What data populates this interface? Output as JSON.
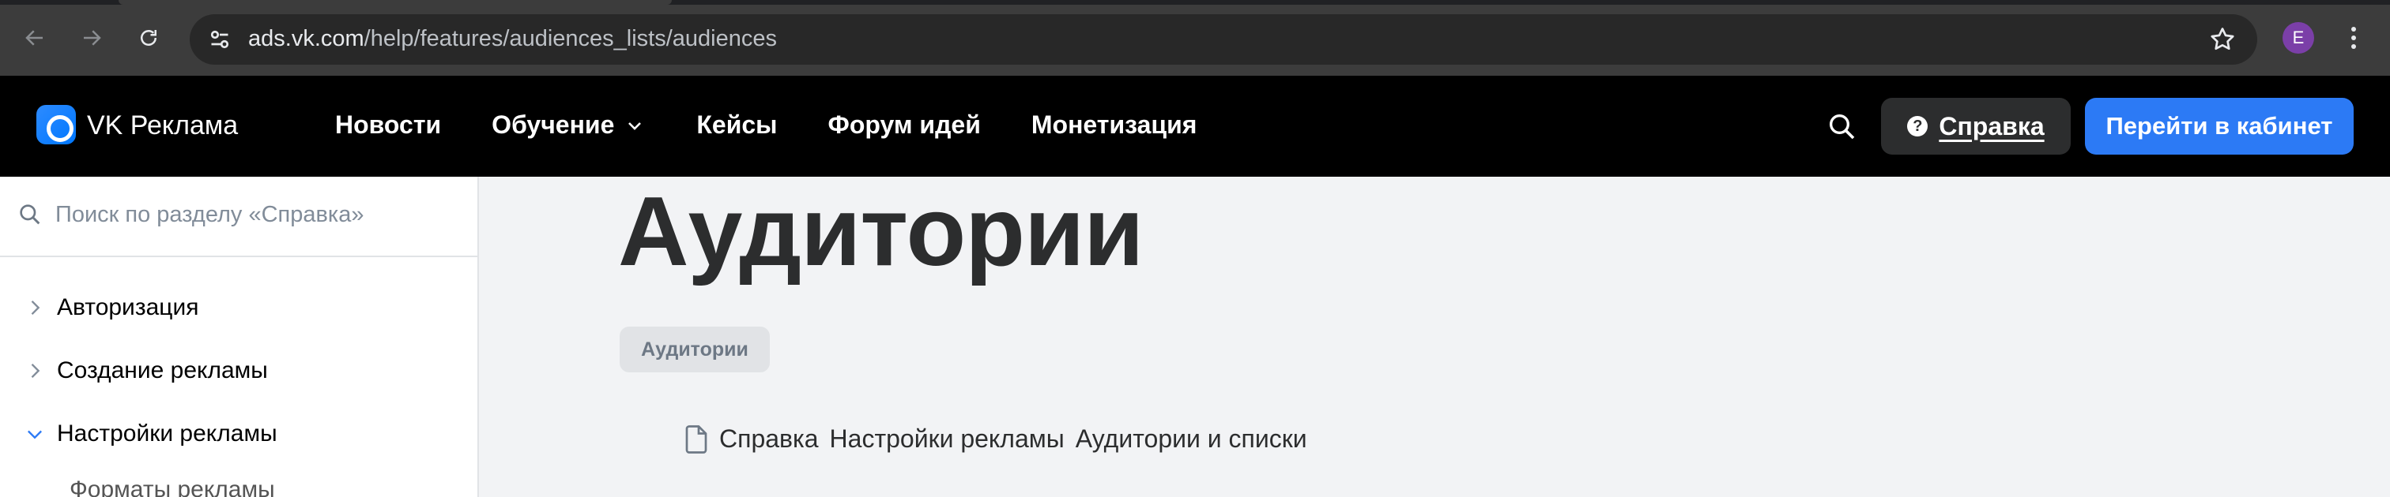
{
  "browser": {
    "url_host": "ads.vk.com",
    "url_path": "/help/features/audiences_lists/audiences",
    "profile_initial": "E"
  },
  "header": {
    "brand": "VK Реклама",
    "nav": [
      "Новости",
      "Обучение",
      "Кейсы",
      "Форум идей",
      "Монетизация"
    ],
    "help_label": "Справка",
    "cabinet_label": "Перейти в кабинет"
  },
  "sidebar": {
    "search_placeholder": "Поиск по разделу «Справка»",
    "items": [
      {
        "label": "Авторизация",
        "expanded": false
      },
      {
        "label": "Создание рекламы",
        "expanded": false
      },
      {
        "label": "Настройки рекламы",
        "expanded": true
      }
    ],
    "subitem": "Форматы рекламы"
  },
  "main": {
    "title": "Аудитории",
    "tag": "Аудитории",
    "breadcrumbs": [
      "Справка",
      "Настройки рекламы",
      "Аудитории и списки"
    ]
  },
  "colors": {
    "accent": "#2c7af5",
    "header_bg": "#000000",
    "page_bg": "#f2f3f5"
  }
}
